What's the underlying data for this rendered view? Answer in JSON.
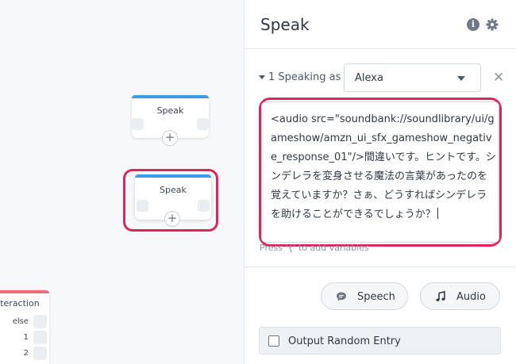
{
  "canvas": {
    "node1": {
      "title": "Speak"
    },
    "node2": {
      "title": "Speak"
    },
    "interaction": {
      "title": "Interaction",
      "rows": [
        "else",
        "1",
        "2"
      ]
    },
    "add_glyph": "+"
  },
  "panel": {
    "title": "Speak",
    "icons": [
      "info-icon",
      "gear-icon"
    ],
    "speaking": {
      "index_label": "1 Speaking as",
      "voice": "Alexa"
    },
    "message": "<audio src=\"soundbank://soundlibrary/ui/gameshow/amzn_ui_sfx_gameshow_negative_response_01\"/>間違いです。ヒントです。シンデレラを変身させる魔法の言葉があったのを覚えていますか？さぁ、どうすればシンデレラを助けることができるでしょうか？",
    "hint": "Press '{' to add variables",
    "buttons": {
      "speech": "Speech",
      "audio": "Audio"
    },
    "random_entry": "Output Random Entry"
  },
  "colors": {
    "accent_blue": "#3d9be9",
    "highlight_red": "#e0245e",
    "interaction_red": "#ef6d79"
  }
}
